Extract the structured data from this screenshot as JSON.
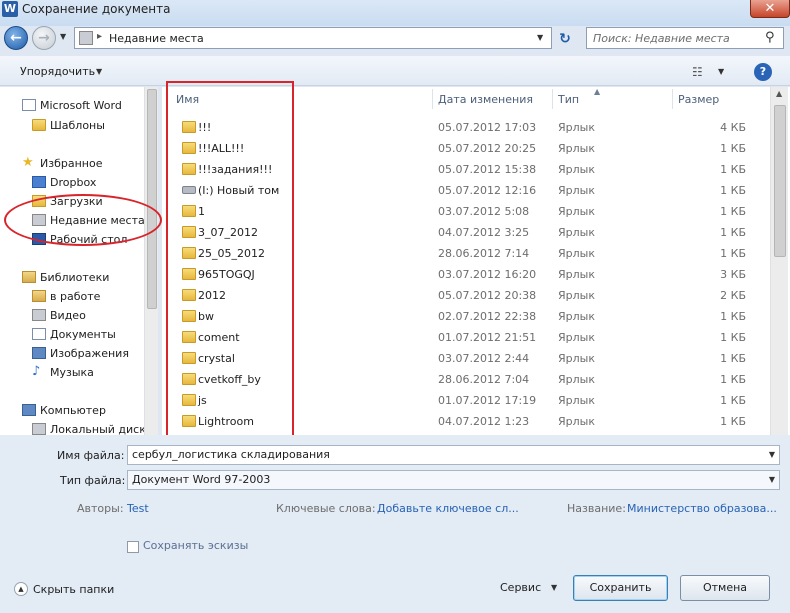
{
  "window": {
    "title": "Сохранение документа",
    "app_icon_letter": "W",
    "close_symbol": "✕"
  },
  "nav_buttons": {
    "back_symbol": "←",
    "forward_symbol": "→",
    "dropdown_symbol": "▼"
  },
  "address_bar": {
    "separator": "▸",
    "path": "Недавние места",
    "dropdown_symbol": "▼",
    "refresh_symbol": "↻"
  },
  "search": {
    "placeholder": "Поиск: Недавние места",
    "icon_symbol": "⚲"
  },
  "toolbar": {
    "organize_label": "Упорядочить",
    "dropdown_symbol": "▼",
    "views_symbol": "☷",
    "help_symbol": "?"
  },
  "sidebar": {
    "items": [
      {
        "label": "Microsoft Word",
        "icon": "word-document-icon"
      },
      {
        "label": "Шаблоны",
        "icon": "folder-icon"
      },
      {
        "label": "Избранное",
        "icon": "star-icon"
      },
      {
        "label": "Dropbox",
        "icon": "dropbox-icon"
      },
      {
        "label": "Загрузки",
        "icon": "downloads-folder-icon"
      },
      {
        "label": "Недавние места",
        "icon": "recent-places-icon"
      },
      {
        "label": "Рабочий стол",
        "icon": "desktop-icon"
      },
      {
        "label": "Библиотеки",
        "icon": "libraries-icon"
      },
      {
        "label": "в работе",
        "icon": "library-folder-icon"
      },
      {
        "label": "Видео",
        "icon": "video-icon"
      },
      {
        "label": "Документы",
        "icon": "documents-icon"
      },
      {
        "label": "Изображения",
        "icon": "images-icon"
      },
      {
        "label": "Музыка",
        "icon": "music-icon"
      },
      {
        "label": "Компьютер",
        "icon": "computer-icon"
      },
      {
        "label": "Локальный диск (",
        "icon": "local-disk-icon"
      }
    ],
    "star_symbol": "★",
    "music_symbol": "♪"
  },
  "file_list": {
    "columns": {
      "name": "Имя",
      "date": "Дата изменения",
      "type": "Тип",
      "size": "Размер"
    },
    "sort_symbol": "▲",
    "scroll_up_symbol": "▲",
    "rows": [
      {
        "name": "!!!",
        "date": "05.07.2012 17:03",
        "type": "Ярлык",
        "size": "4 КБ"
      },
      {
        "name": "!!!ALL!!!",
        "date": "05.07.2012 20:25",
        "type": "Ярлык",
        "size": "1 КБ"
      },
      {
        "name": "!!!задания!!!",
        "date": "05.07.2012 15:38",
        "type": "Ярлык",
        "size": "1 КБ"
      },
      {
        "name": "(I:) Новый том",
        "date": "05.07.2012 12:16",
        "type": "Ярлык",
        "size": "1 КБ",
        "drive": true
      },
      {
        "name": "1",
        "date": "03.07.2012 5:08",
        "type": "Ярлык",
        "size": "1 КБ"
      },
      {
        "name": "3_07_2012",
        "date": "04.07.2012 3:25",
        "type": "Ярлык",
        "size": "1 КБ"
      },
      {
        "name": "25_05_2012",
        "date": "28.06.2012 7:14",
        "type": "Ярлык",
        "size": "1 КБ"
      },
      {
        "name": "965TOGQJ",
        "date": "03.07.2012 16:20",
        "type": "Ярлык",
        "size": "3 КБ"
      },
      {
        "name": "2012",
        "date": "05.07.2012 20:38",
        "type": "Ярлык",
        "size": "2 КБ"
      },
      {
        "name": "bw",
        "date": "02.07.2012 22:38",
        "type": "Ярлык",
        "size": "1 КБ"
      },
      {
        "name": "coment",
        "date": "01.07.2012 21:51",
        "type": "Ярлык",
        "size": "1 КБ"
      },
      {
        "name": "crystal",
        "date": "03.07.2012 2:44",
        "type": "Ярлык",
        "size": "1 КБ"
      },
      {
        "name": "cvetkoff_by",
        "date": "28.06.2012 7:04",
        "type": "Ярлык",
        "size": "1 КБ"
      },
      {
        "name": "js",
        "date": "01.07.2012 17:19",
        "type": "Ярлык",
        "size": "1 КБ"
      },
      {
        "name": "Lightroom",
        "date": "04.07.2012 1:23",
        "type": "Ярлык",
        "size": "1 КБ"
      }
    ]
  },
  "form": {
    "filename_label": "Имя файла:",
    "filename_value": "сербул_логистика складирования",
    "filetype_label": "Тип файла:",
    "filetype_value": "Документ Word 97-2003",
    "dropdown_symbol": "▼",
    "authors_label": "Авторы:",
    "authors_value": "Test",
    "keywords_label": "Ключевые слова:",
    "keywords_value": "Добавьте ключевое сл...",
    "title_label": "Название:",
    "title_value": "Министерство образова...",
    "thumbnails_label": "Сохранять эскизы",
    "hide_folders_label": "Скрыть папки",
    "hide_symbol": "▲",
    "tools_label": "Сервис",
    "save_label": "Сохранить",
    "cancel_label": "Отмена"
  },
  "colors": {
    "highlight": "#d8242a",
    "link": "#2763b4",
    "accent": "#1f5aa6"
  }
}
